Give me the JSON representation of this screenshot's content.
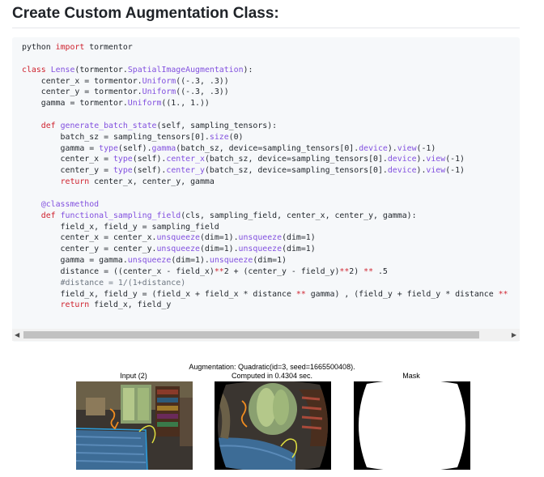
{
  "heading": "Create Custom Augmentation Class:",
  "code_lines": [
    "python import tormentor",
    "",
    "class Lense(tormentor.SpatialImageAugmentation):",
    "    center_x = tormentor.Uniform((-.3, .3))",
    "    center_y = tormentor.Uniform((-.3, .3))",
    "    gamma = tormentor.Uniform((1., 1.))",
    "",
    "    def generate_batch_state(self, sampling_tensors):",
    "        batch_sz = sampling_tensors[0].size(0)",
    "        gamma = type(self).gamma(batch_sz, device=sampling_tensors[0].device).view(-1)",
    "        center_x = type(self).center_x(batch_sz, device=sampling_tensors[0].device).view(-1)",
    "        center_y = type(self).center_y(batch_sz, device=sampling_tensors[0].device).view(-1)",
    "        return center_x, center_y, gamma",
    "",
    "    @classmethod",
    "    def functional_sampling_field(cls, sampling_field, center_x, center_y, gamma):",
    "        field_x, field_y = sampling_field",
    "        center_x = center_x.unsqueeze(dim=1).unsqueeze(dim=1)",
    "        center_y = center_y.unsqueeze(dim=1).unsqueeze(dim=1)",
    "        gamma = gamma.unsqueeze(dim=1).unsqueeze(dim=1)",
    "        distance = ((center_x - field_x)**2 + (center_y - field_y)**2) ** .5",
    "        #distance = 1/(1+distance)",
    "        field_x, field_y = (field_x + field_x * distance ** gamma) , (field_y + field_y * distance **",
    "        return field_x, field_y"
  ],
  "scrollbar": {
    "left_arrow": "◀",
    "right_arrow": "▶"
  },
  "figure": {
    "title": "Augmentation: Quadratic(id=3, seed=1665500408).",
    "panels": [
      {
        "caption": "Input (2)"
      },
      {
        "caption": "Computed in 0.4304 sec."
      },
      {
        "caption": "Mask"
      }
    ]
  },
  "colors": {
    "keyword": "#cf222e",
    "function": "#8250df",
    "comment": "#6e7781",
    "code_bg": "#f6f8fa"
  }
}
